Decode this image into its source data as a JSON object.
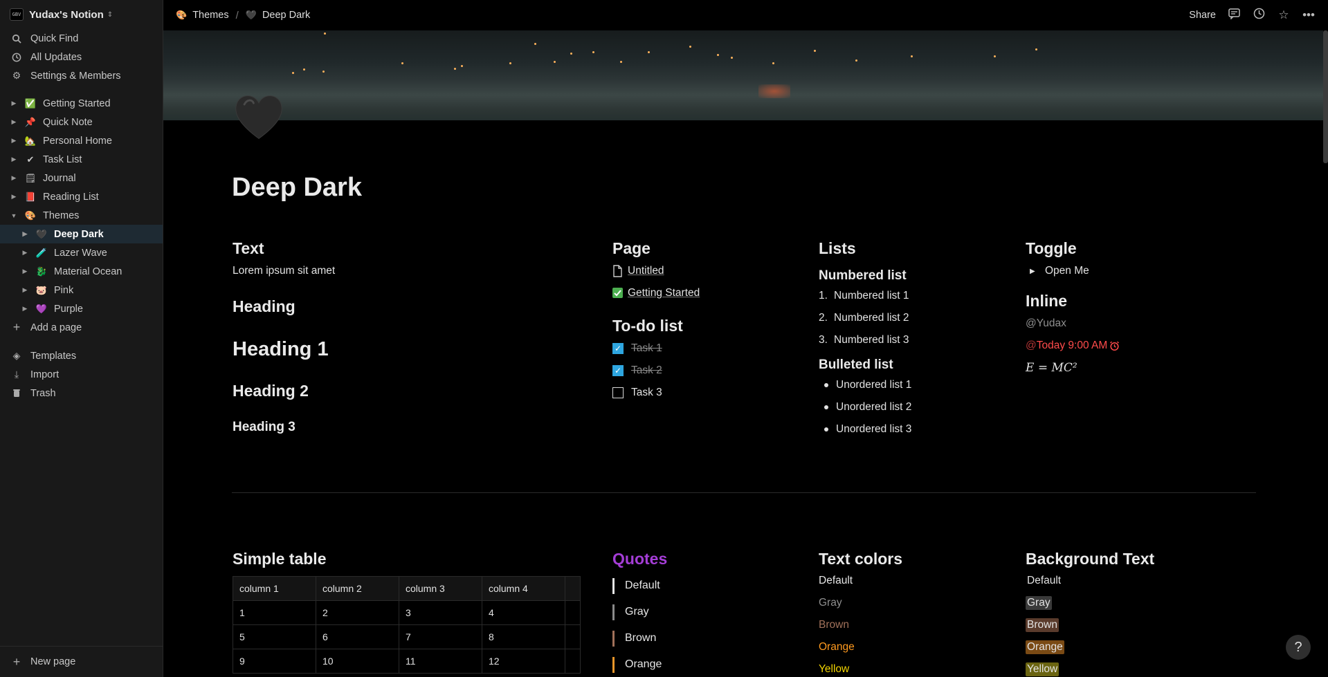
{
  "sidebar": {
    "workspace_logo": "GBV",
    "workspace_name": "Yudax's Notion",
    "quick_find": "Quick Find",
    "all_updates": "All Updates",
    "settings": "Settings & Members",
    "pages": [
      {
        "label": "Getting Started",
        "emoji": "✅"
      },
      {
        "label": "Quick Note",
        "emoji": "📌"
      },
      {
        "label": "Personal Home",
        "emoji": "🏡"
      },
      {
        "label": "Task List",
        "emoji": "✔"
      },
      {
        "label": "Journal",
        "emoji": "🗒"
      },
      {
        "label": "Reading List",
        "emoji": "📕"
      },
      {
        "label": "Themes",
        "emoji": "🎨"
      }
    ],
    "theme_pages": [
      {
        "label": "Deep Dark",
        "emoji": "🖤"
      },
      {
        "label": "Lazer Wave",
        "emoji": "🧪"
      },
      {
        "label": "Material Ocean",
        "emoji": "🐉"
      },
      {
        "label": "Pink",
        "emoji": "🐷"
      },
      {
        "label": "Purple",
        "emoji": "💜"
      }
    ],
    "add_page": "Add a page",
    "templates": "Templates",
    "import": "Import",
    "trash": "Trash",
    "new_page": "New page"
  },
  "topbar": {
    "crumb_parent": "Themes",
    "crumb_parent_emoji": "🎨",
    "crumb_current": "Deep Dark",
    "crumb_current_emoji": "🖤",
    "share": "Share"
  },
  "page": {
    "title": "Deep Dark",
    "icon": "black-heart-icon"
  },
  "text_col": {
    "heading": "Text",
    "body": "Lorem ipsum sit amet",
    "heading_plain": "Heading",
    "h1": "Heading 1",
    "h2": "Heading 2",
    "h3": "Heading 3"
  },
  "page_col": {
    "heading": "Page",
    "links": [
      "Untitled",
      "Getting Started"
    ],
    "todo_heading": "To-do list",
    "todos": [
      {
        "label": "Task 1",
        "checked": true
      },
      {
        "label": "Task 2",
        "checked": true
      },
      {
        "label": "Task 3",
        "checked": false
      }
    ]
  },
  "lists_col": {
    "heading": "Lists",
    "numbered_heading": "Numbered list",
    "numbered": [
      "Numbered list 1",
      "Numbered list 2",
      "Numbered list 3"
    ],
    "bulleted_heading": "Bulleted list",
    "bulleted": [
      "Unordered list 1",
      "Unordered list 2",
      "Unordered list 3"
    ]
  },
  "toggle_col": {
    "heading": "Toggle",
    "toggle_label": "Open Me",
    "inline_heading": "Inline",
    "mention": "@Yudax",
    "date_mention_at": "@",
    "date_mention": "Today 9:00 AM",
    "equation": "E = MC²"
  },
  "table_section": {
    "heading": "Simple table",
    "rows": [
      [
        "column 1",
        "column 2",
        "column 3",
        "column 4"
      ],
      [
        "1",
        "2",
        "3",
        "4"
      ],
      [
        "5",
        "6",
        "7",
        "8"
      ],
      [
        "9",
        "10",
        "11",
        "12"
      ]
    ]
  },
  "quotes_section": {
    "heading": "Quotes",
    "heading_color": "#a43dd6",
    "items": [
      {
        "label": "Default",
        "color": "#e6e6e6"
      },
      {
        "label": "Gray",
        "color": "#8a8a8a"
      },
      {
        "label": "Brown",
        "color": "#a1715a"
      },
      {
        "label": "Orange",
        "color": "#e8962a"
      }
    ]
  },
  "text_colors_section": {
    "heading": "Text colors",
    "items": [
      {
        "label": "Default",
        "color": "#e6e6e6"
      },
      {
        "label": "Gray",
        "color": "#8f8f8f"
      },
      {
        "label": "Brown",
        "color": "#a1715a"
      },
      {
        "label": "Orange",
        "color": "#ff9a1f"
      },
      {
        "label": "Yellow",
        "color": "#f2d400"
      }
    ]
  },
  "bg_text_section": {
    "heading": "Background Text",
    "items": [
      {
        "label": "Default",
        "bg": "transparent"
      },
      {
        "label": "Gray",
        "bg": "#3a3a3a"
      },
      {
        "label": "Brown",
        "bg": "#5a3b2c"
      },
      {
        "label": "Orange",
        "bg": "#7a4a14"
      },
      {
        "label": "Yellow",
        "bg": "#6a6410"
      }
    ]
  },
  "help": "?",
  "colors": {
    "accent_blue": "#2ea6e0",
    "date_red": "#ff4b4b",
    "active_row": "#1e2a33"
  }
}
